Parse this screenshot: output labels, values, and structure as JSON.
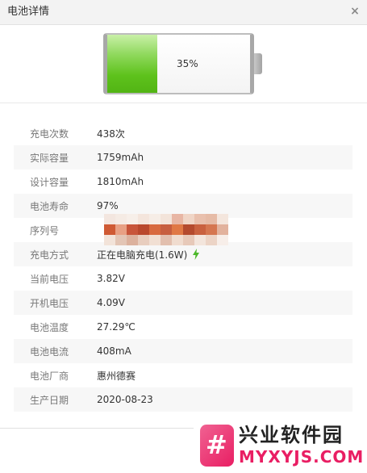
{
  "window": {
    "title": "电池详情",
    "close_glyph": "×"
  },
  "battery": {
    "percent_label": "35%",
    "level": 0.35,
    "fill_color": "#5ec21c"
  },
  "details": [
    {
      "label": "充电次数",
      "value": "438次"
    },
    {
      "label": "实际容量",
      "value": "1759mAh"
    },
    {
      "label": "设计容量",
      "value": "1810mAh"
    },
    {
      "label": "电池寿命",
      "value": "97%"
    },
    {
      "label": "序列号",
      "value": ""
    },
    {
      "label": "充电方式",
      "value": "正在电脑充电(1.6W)",
      "icon": "lightning-bolt-icon"
    },
    {
      "label": "当前电压",
      "value": "3.82V"
    },
    {
      "label": "开机电压",
      "value": "4.09V"
    },
    {
      "label": "电池温度",
      "value": "27.29℃"
    },
    {
      "label": "电池电流",
      "value": "408mA"
    },
    {
      "label": "电池厂商",
      "value": "惠州德赛"
    },
    {
      "label": "生产日期",
      "value": "2020-08-23"
    }
  ],
  "watermark": {
    "name": "兴业软件园",
    "url": "MYXYJS.COM",
    "logo_glyph": "#",
    "accent_color": "#e91e63"
  }
}
